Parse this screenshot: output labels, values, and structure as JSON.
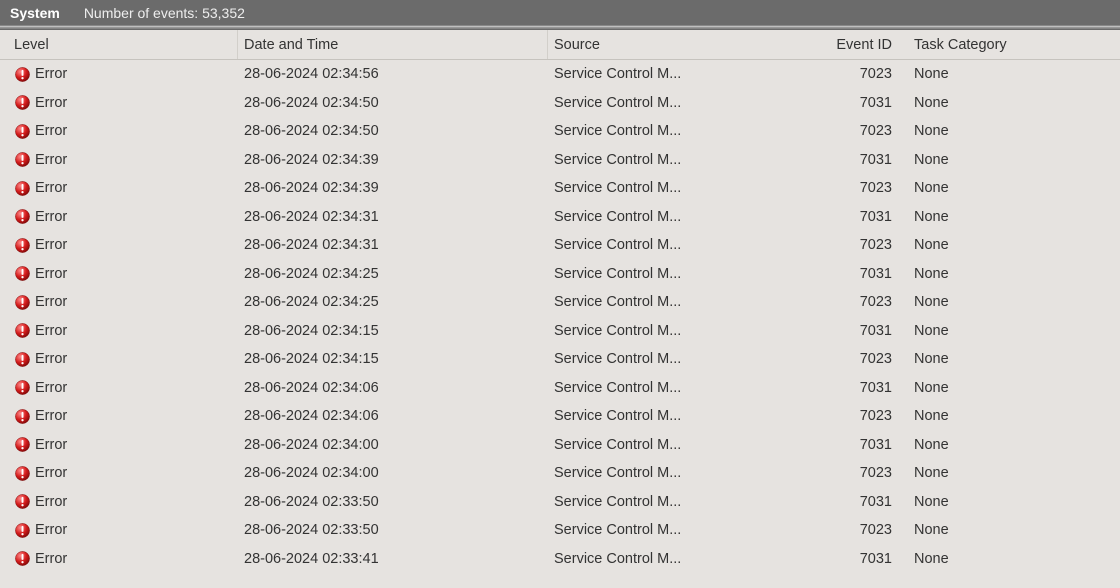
{
  "header": {
    "title": "System",
    "subtitle": "Number of events: 53,352"
  },
  "columns": {
    "level": "Level",
    "date": "Date and Time",
    "source": "Source",
    "eventid": "Event ID",
    "taskcat": "Task Category"
  },
  "rows": [
    {
      "level": "Error",
      "date": "28-06-2024 02:34:56",
      "source": "Service Control M...",
      "eventid": "7023",
      "taskcat": "None"
    },
    {
      "level": "Error",
      "date": "28-06-2024 02:34:50",
      "source": "Service Control M...",
      "eventid": "7031",
      "taskcat": "None"
    },
    {
      "level": "Error",
      "date": "28-06-2024 02:34:50",
      "source": "Service Control M...",
      "eventid": "7023",
      "taskcat": "None"
    },
    {
      "level": "Error",
      "date": "28-06-2024 02:34:39",
      "source": "Service Control M...",
      "eventid": "7031",
      "taskcat": "None"
    },
    {
      "level": "Error",
      "date": "28-06-2024 02:34:39",
      "source": "Service Control M...",
      "eventid": "7023",
      "taskcat": "None"
    },
    {
      "level": "Error",
      "date": "28-06-2024 02:34:31",
      "source": "Service Control M...",
      "eventid": "7031",
      "taskcat": "None"
    },
    {
      "level": "Error",
      "date": "28-06-2024 02:34:31",
      "source": "Service Control M...",
      "eventid": "7023",
      "taskcat": "None"
    },
    {
      "level": "Error",
      "date": "28-06-2024 02:34:25",
      "source": "Service Control M...",
      "eventid": "7031",
      "taskcat": "None"
    },
    {
      "level": "Error",
      "date": "28-06-2024 02:34:25",
      "source": "Service Control M...",
      "eventid": "7023",
      "taskcat": "None"
    },
    {
      "level": "Error",
      "date": "28-06-2024 02:34:15",
      "source": "Service Control M...",
      "eventid": "7031",
      "taskcat": "None"
    },
    {
      "level": "Error",
      "date": "28-06-2024 02:34:15",
      "source": "Service Control M...",
      "eventid": "7023",
      "taskcat": "None"
    },
    {
      "level": "Error",
      "date": "28-06-2024 02:34:06",
      "source": "Service Control M...",
      "eventid": "7031",
      "taskcat": "None"
    },
    {
      "level": "Error",
      "date": "28-06-2024 02:34:06",
      "source": "Service Control M...",
      "eventid": "7023",
      "taskcat": "None"
    },
    {
      "level": "Error",
      "date": "28-06-2024 02:34:00",
      "source": "Service Control M...",
      "eventid": "7031",
      "taskcat": "None"
    },
    {
      "level": "Error",
      "date": "28-06-2024 02:34:00",
      "source": "Service Control M...",
      "eventid": "7023",
      "taskcat": "None"
    },
    {
      "level": "Error",
      "date": "28-06-2024 02:33:50",
      "source": "Service Control M...",
      "eventid": "7031",
      "taskcat": "None"
    },
    {
      "level": "Error",
      "date": "28-06-2024 02:33:50",
      "source": "Service Control M...",
      "eventid": "7023",
      "taskcat": "None"
    },
    {
      "level": "Error",
      "date": "28-06-2024 02:33:41",
      "source": "Service Control M...",
      "eventid": "7031",
      "taskcat": "None"
    }
  ]
}
